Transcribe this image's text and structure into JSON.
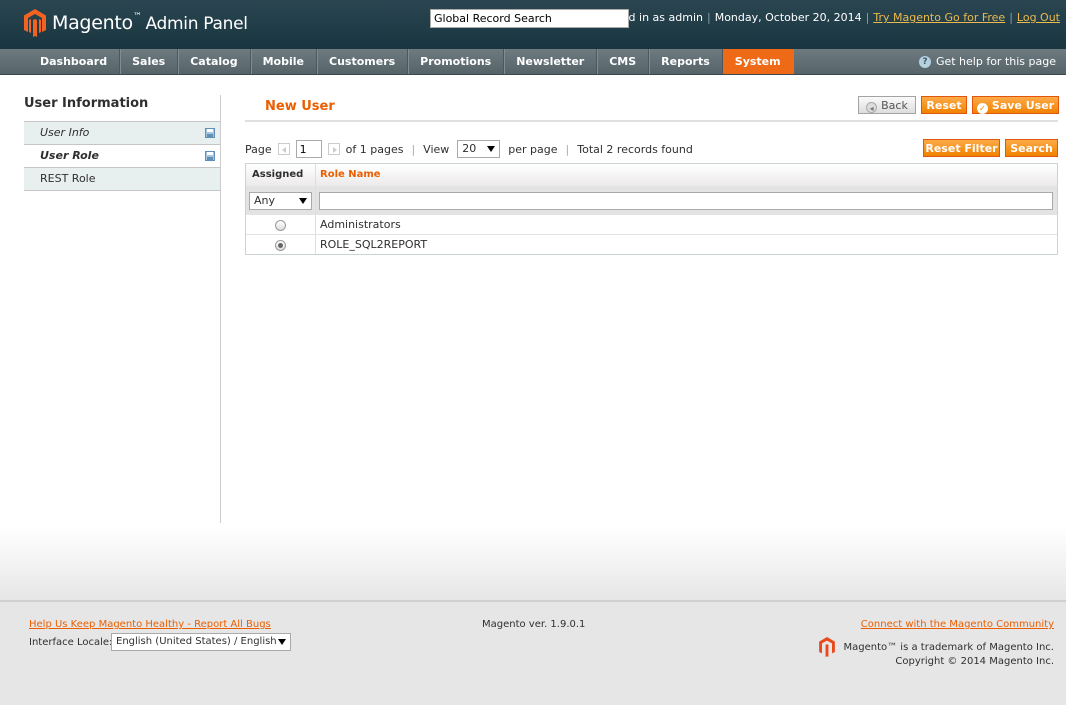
{
  "header": {
    "brand": "Magento",
    "brand_sub": "Admin Panel",
    "search_value": "Global Record Search",
    "logged_in": "Logged in as admin",
    "date": "Monday, October 20, 2014",
    "try_link": "Try Magento Go for Free",
    "logout": "Log Out"
  },
  "nav": {
    "items": [
      "Dashboard",
      "Sales",
      "Catalog",
      "Mobile",
      "Customers",
      "Promotions",
      "Newsletter",
      "CMS",
      "Reports",
      "System"
    ],
    "active": "System",
    "help": "Get help for this page"
  },
  "side": {
    "title": "User Information",
    "tabs": [
      "User Info",
      "User Role",
      "REST Role"
    ]
  },
  "main": {
    "title": "New User",
    "buttons": {
      "back": "Back",
      "reset": "Reset",
      "save": "Save User",
      "reset_filter": "Reset Filter",
      "search": "Search"
    },
    "pager": {
      "page_label": "Page",
      "page": "1",
      "of_pages": "of 1 pages",
      "view_label": "View",
      "view": "20",
      "per_page": "per page",
      "total": "Total 2 records found"
    },
    "grid": {
      "headers": [
        "Assigned",
        "Role Name"
      ],
      "assigned_filter": "Any",
      "rows": [
        {
          "role": "Administrators",
          "assigned": false
        },
        {
          "role": "ROLE_SQL2REPORT",
          "assigned": true
        }
      ]
    }
  },
  "footer": {
    "bugs_link": "Help Us Keep Magento Healthy - Report All Bugs",
    "locale_label": "Interface Locale:",
    "locale_value": "English (United States) / English",
    "version": "Magento ver. 1.9.0.1",
    "community_link": "Connect with the Magento Community",
    "trademark": "Magento™ is a trademark of Magento Inc.",
    "copyright": "Copyright © 2014 Magento Inc."
  },
  "colors": {
    "accent": "#eb5e00",
    "header_bg": "#1f3c47",
    "nav_bg": "#5e6d73",
    "button_orange": "#f18200"
  }
}
